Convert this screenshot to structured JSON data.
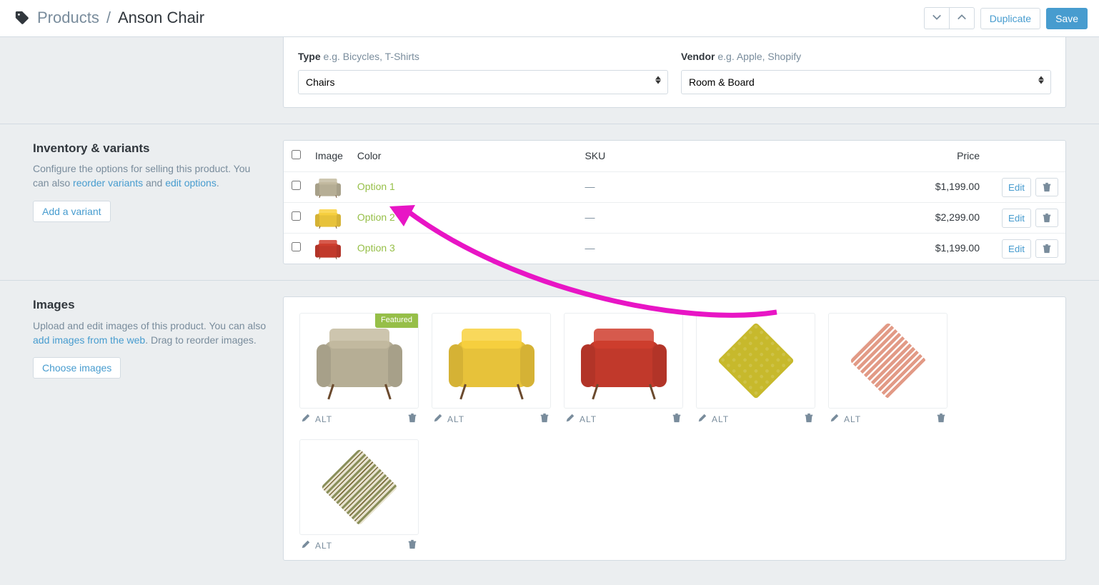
{
  "header": {
    "breadcrumb_root": "Products",
    "breadcrumb_sep": "/",
    "title": "Anson Chair",
    "duplicate": "Duplicate",
    "save": "Save"
  },
  "type_field": {
    "label": "Type",
    "hint": "e.g. Bicycles, T-Shirts",
    "value": "Chairs"
  },
  "vendor_field": {
    "label": "Vendor",
    "hint": "e.g. Apple, Shopify",
    "value": "Room & Board"
  },
  "variants_side": {
    "title": "Inventory & variants",
    "desc_pre": "Configure the options for selling this product. You can also ",
    "link1": "reorder variants",
    "mid": " and ",
    "link2": "edit options",
    "suffix": ".",
    "add_btn": "Add a variant"
  },
  "variants_table": {
    "cols": {
      "image": "Image",
      "option": "Color",
      "sku": "SKU",
      "price": "Price"
    },
    "rows": [
      {
        "name": "Option 1",
        "sku": "—",
        "price": "$1,199.00",
        "color": "#b6ae95",
        "edit": "Edit"
      },
      {
        "name": "Option 2",
        "sku": "—",
        "price": "$2,299.00",
        "color": "#e7c23a",
        "edit": "Edit"
      },
      {
        "name": "Option 3",
        "sku": "—",
        "price": "$1,199.00",
        "color": "#c1392b",
        "edit": "Edit"
      }
    ]
  },
  "images_side": {
    "title": "Images",
    "desc_pre": "Upload and edit images of this product. You can also ",
    "link": "add images from the web",
    "desc_post": ". Drag to reorder images.",
    "choose_btn": "Choose images"
  },
  "images": {
    "alt_label": "ALT",
    "featured": "Featured",
    "items": [
      {
        "kind": "chair",
        "color": "#b6ae95",
        "featured": true
      },
      {
        "kind": "chair",
        "color": "#e7c23a",
        "featured": false
      },
      {
        "kind": "chair",
        "color": "#c1392b",
        "featured": false
      },
      {
        "kind": "pillow",
        "color": "#c7b92c",
        "pattern": "circles",
        "featured": false
      },
      {
        "kind": "pillow",
        "color": "#e29a86",
        "pattern": "stripes-v",
        "featured": false
      },
      {
        "kind": "pillow",
        "color": "#8a8f5a",
        "pattern": "stripes-v2",
        "featured": false
      }
    ]
  },
  "annotation": {
    "arrow_color": "#e815c5"
  }
}
